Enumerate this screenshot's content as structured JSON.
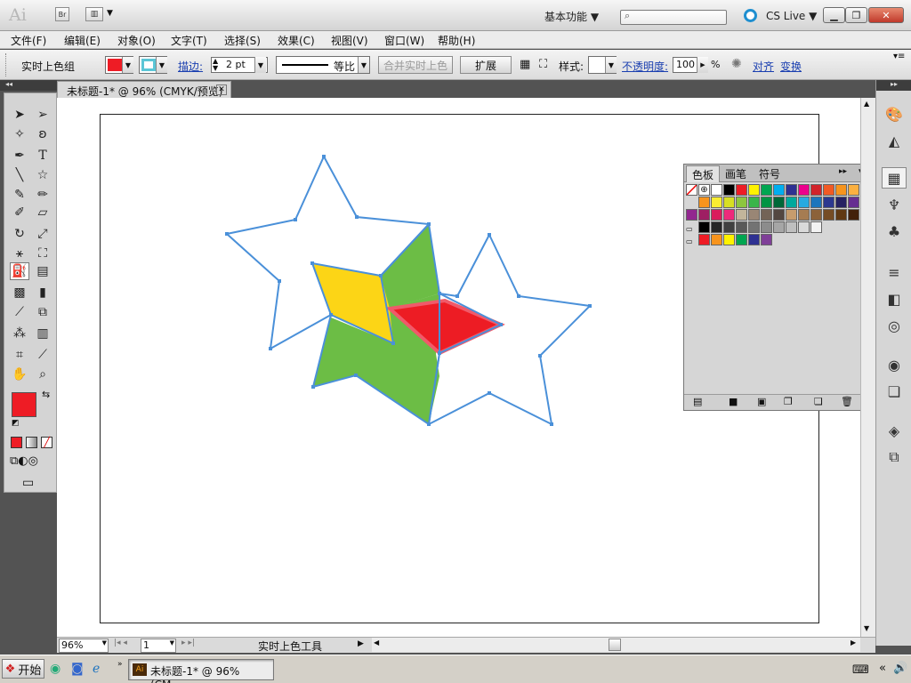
{
  "app": {
    "logo": "Ai",
    "br": "Br",
    "workspace": "基本功能",
    "cslive": "CS Live"
  },
  "menu": [
    "文件(F)",
    "编辑(E)",
    "对象(O)",
    "文字(T)",
    "选择(S)",
    "效果(C)",
    "视图(V)",
    "窗口(W)",
    "帮助(H)"
  ],
  "control": {
    "tool_name": "实时上色组",
    "stroke_label": "描边:",
    "stroke_value": "2 pt",
    "profile": "等比",
    "merge_btn": "合并实时上色",
    "expand_btn": "扩展",
    "style_label": "样式:",
    "opacity_label": "不透明度:",
    "opacity_value": "100",
    "opacity_unit": "%",
    "align": "对齐",
    "transform": "变换",
    "fill_color": "#ee1c25",
    "stroke_color": "#5bc6d6"
  },
  "document": {
    "tab": "未标题-1* @ 96% (CMYK/预览)"
  },
  "status": {
    "zoom": "96%",
    "page": "1",
    "tool": "实时上色工具"
  },
  "swatches": {
    "tabs": [
      "色板",
      "画笔",
      "符号"
    ],
    "rows": [
      [
        "#ffffff",
        "#000000",
        "#ee1c25",
        "#fff200",
        "#00a651",
        "#00aeef",
        "#2e3192",
        "#ec008c",
        "#d2232a",
        "#f15a24",
        "#f7941d",
        "#fbb040"
      ],
      [
        "#f7941d",
        "#f9ed32",
        "#d7df23",
        "#8dc63f",
        "#39b54a",
        "#009444",
        "#006838",
        "#00a99d",
        "#27aae1",
        "#1c75bc",
        "#2b388f",
        "#262262",
        "#662d91"
      ],
      [
        "#92278f",
        "#9e1f63",
        "#da1c5c",
        "#ee2a7b",
        "#c2b59b",
        "#998675",
        "#736357",
        "#534741",
        "#c69c6d",
        "#a67c52",
        "#8c6239",
        "#754c24",
        "#603913",
        "#42210b"
      ],
      [
        "#000000",
        "#262626",
        "#404040",
        "#595959",
        "#737373",
        "#8c8c8c",
        "#a6a6a6",
        "#bfbfbf",
        "#d9d9d9",
        "#f2f2f2"
      ],
      [
        "#ee1c25",
        "#f7941d",
        "#fff200",
        "#00a651",
        "#2e3192",
        "#7f3f98"
      ]
    ]
  },
  "taskbar": {
    "start": "开始",
    "item": "未标题-1* @ 96% (CM..."
  }
}
